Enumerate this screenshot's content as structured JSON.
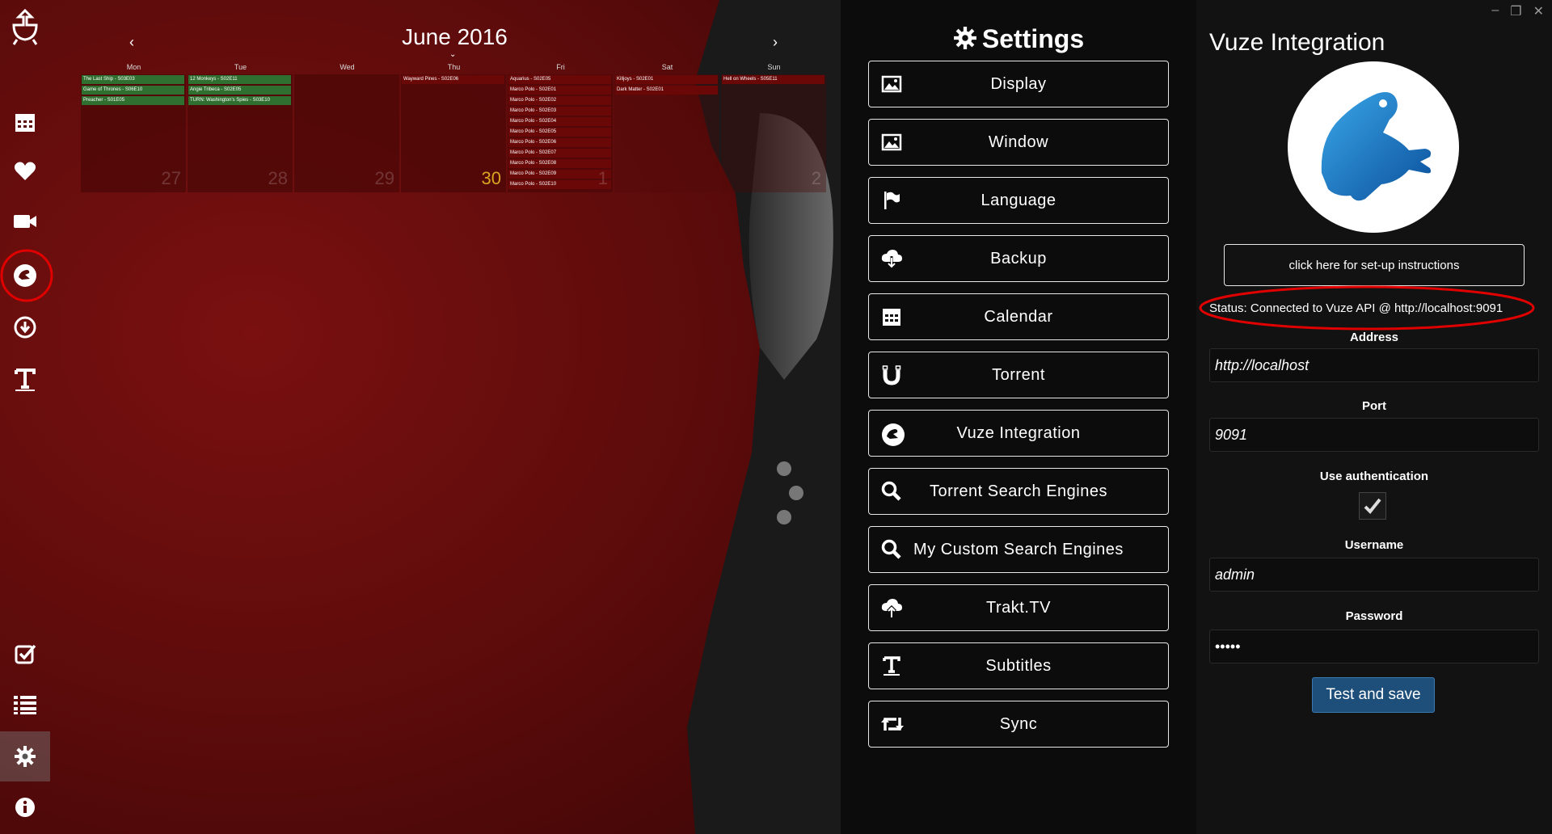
{
  "calendar": {
    "month_title": "June 2016",
    "prev_label": "‹",
    "next_label": "›",
    "days": [
      {
        "name": "Mon",
        "num": "27",
        "events": [
          {
            "t": "The Last Ship - S03E03",
            "c": "g"
          },
          {
            "t": "Game of Thrones - S06E10",
            "c": "g"
          },
          {
            "t": "Preacher - S01E05",
            "c": "g"
          }
        ]
      },
      {
        "name": "Tue",
        "num": "28",
        "events": [
          {
            "t": "12 Monkeys - S02E11",
            "c": "g"
          },
          {
            "t": "Angie Tribeca - S02E05",
            "c": "g"
          },
          {
            "t": "TURN: Washington's Spies - S03E10",
            "c": "g"
          }
        ]
      },
      {
        "name": "Wed",
        "num": "29",
        "events": []
      },
      {
        "name": "Thu",
        "num": "30",
        "today": true,
        "events": [
          {
            "t": "Wayward Pines - S02E06",
            "c": "r"
          }
        ]
      },
      {
        "name": "Fri",
        "num": "1",
        "events": [
          {
            "t": "Aquarius - S02E05",
            "c": "r"
          },
          {
            "t": "Marco Polo - S02E01",
            "c": "r"
          },
          {
            "t": "Marco Polo - S02E02",
            "c": "r"
          },
          {
            "t": "Marco Polo - S02E03",
            "c": "r"
          },
          {
            "t": "Marco Polo - S02E04",
            "c": "r"
          },
          {
            "t": "Marco Polo - S02E05",
            "c": "r"
          },
          {
            "t": "Marco Polo - S02E06",
            "c": "r"
          },
          {
            "t": "Marco Polo - S02E07",
            "c": "r"
          },
          {
            "t": "Marco Polo - S02E08",
            "c": "r"
          },
          {
            "t": "Marco Polo - S02E09",
            "c": "r"
          },
          {
            "t": "Marco Polo - S02E10",
            "c": "r"
          }
        ]
      },
      {
        "name": "Sat",
        "num": "",
        "events": [
          {
            "t": "Killjoys - S02E01",
            "c": "r"
          },
          {
            "t": "Dark Matter - S02E01",
            "c": "r"
          }
        ]
      },
      {
        "name": "Sun",
        "num": "2",
        "events": [
          {
            "t": "Hell on Wheels - S05E11",
            "c": "r"
          }
        ]
      }
    ]
  },
  "sidebar": {
    "top_icons": [
      "logo-icon",
      "calendar-icon",
      "heart-icon",
      "video-icon",
      "vuze-icon",
      "download-icon",
      "subtitles-icon"
    ],
    "bottom_icons": [
      "checklist-icon",
      "list-icon",
      "gear-icon",
      "info-icon"
    ]
  },
  "settings": {
    "title": "Settings",
    "items": [
      {
        "label": "Display",
        "icon": "image-icon"
      },
      {
        "label": "Window",
        "icon": "image-icon"
      },
      {
        "label": "Language",
        "icon": "flag-icon"
      },
      {
        "label": "Backup",
        "icon": "cloud-download-icon"
      },
      {
        "label": "Calendar",
        "icon": "calendar-icon"
      },
      {
        "label": "Torrent",
        "icon": "magnet-icon"
      },
      {
        "label": "Vuze Integration",
        "icon": "vuze-icon"
      },
      {
        "label": "Torrent Search Engines",
        "icon": "search-icon"
      },
      {
        "label": "My Custom Search Engines",
        "icon": "search-icon"
      },
      {
        "label": "Trakt.TV",
        "icon": "cloud-upload-icon"
      },
      {
        "label": "Subtitles",
        "icon": "text-icon"
      },
      {
        "label": "Sync",
        "icon": "retweet-icon"
      }
    ]
  },
  "vuze": {
    "title": "Vuze Integration",
    "setup_label": "click here for set-up instructions",
    "status": "Status: Connected to Vuze API @ http://localhost:9091",
    "address_label": "Address",
    "address_value": "http://localhost",
    "port_label": "Port",
    "port_value": "9091",
    "auth_label": "Use authentication",
    "auth_checked": true,
    "username_label": "Username",
    "username_value": "admin",
    "password_label": "Password",
    "password_value": "•••••",
    "save_label": "Test and save",
    "accent": "#1d4f7a"
  },
  "colors": {
    "background": "#5a0b0b",
    "annotation": "#e00000"
  }
}
